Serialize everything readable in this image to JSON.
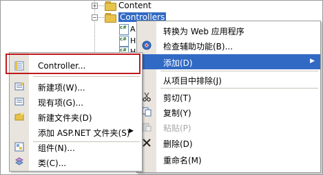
{
  "tree": {
    "items": [
      {
        "label": "Content"
      },
      {
        "label": "Controllers"
      }
    ],
    "children": [
      {
        "icon_text": "c#",
        "tail": "A"
      },
      {
        "icon_text": "c#",
        "tail": "H"
      },
      {
        "icon_text": "c#",
        "tail": "H"
      }
    ]
  },
  "left_menu": {
    "items": [
      {
        "label": "Controller...",
        "icon": "controller-icon"
      },
      {
        "label": "新建项(W)...",
        "icon": "new-item-icon"
      },
      {
        "label": "现有项(G)...",
        "icon": "existing-item-icon"
      },
      {
        "label": "新建文件夹(D)",
        "icon": "new-folder-icon"
      },
      {
        "label": "添加 ASP.NET 文件夹(S)",
        "icon": "",
        "submenu": true
      },
      {
        "label": "组件(N)...",
        "icon": "component-icon"
      },
      {
        "label": "类(C)...",
        "icon": "class-icon"
      }
    ]
  },
  "right_menu": {
    "items": [
      {
        "label": "转换为 Web 应用程序",
        "icon": ""
      },
      {
        "label": "检查辅助功能(B)...",
        "icon": "accessibility-icon"
      },
      {
        "label": "添加(D)",
        "icon": "",
        "active": true,
        "submenu": true
      },
      {
        "label": "从项目中排除(J)",
        "icon": ""
      },
      {
        "label": "剪切(T)",
        "icon": "cut-icon"
      },
      {
        "label": "复制(Y)",
        "icon": "copy-icon"
      },
      {
        "label": "粘贴(P)",
        "icon": "paste-icon",
        "disabled": true
      },
      {
        "label": "删除(D)",
        "icon": "delete-icon"
      },
      {
        "label": "重命名(M)",
        "icon": ""
      }
    ]
  },
  "colors": {
    "highlight": "#316ac5",
    "callout_border": "#c0181c",
    "icon_bar": "#e9e5de"
  }
}
